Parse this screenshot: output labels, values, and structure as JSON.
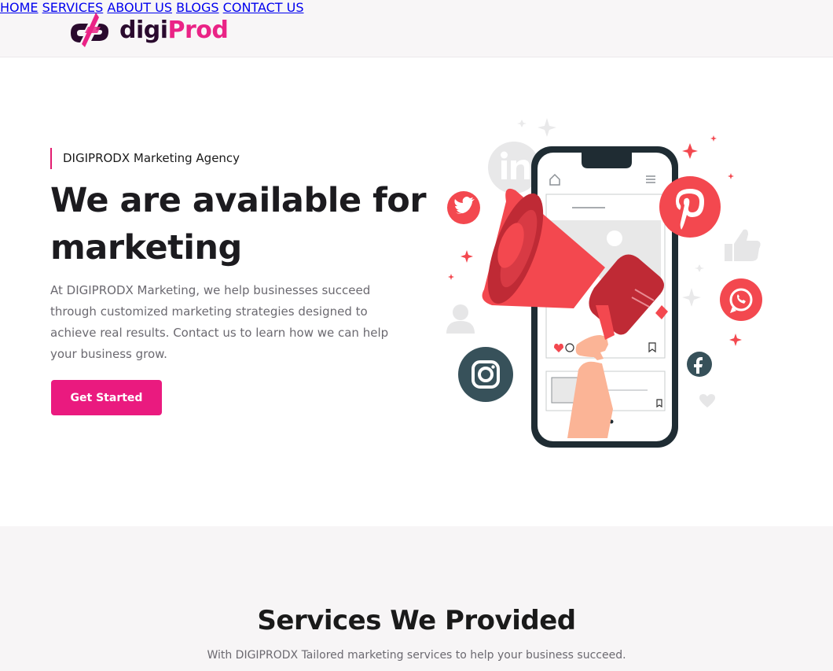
{
  "brand": {
    "name_part1": "digi",
    "name_part2": "Prod",
    "accent_color": "#ea1a7f",
    "dark_color": "#2a0a2e"
  },
  "nav": {
    "items": [
      {
        "label": "HOME"
      },
      {
        "label": "SERVICES"
      },
      {
        "label": "ABOUT US"
      },
      {
        "label": "BLOGS"
      },
      {
        "label": "CONTACT US"
      }
    ]
  },
  "hero": {
    "eyebrow": "DIGIPRODX Marketing Agency",
    "title": "We are available for marketing",
    "description": "At DIGIPRODX Marketing, we help businesses succeed through customized marketing strategies designed to achieve real results. Contact us to learn how we can help your business grow.",
    "cta_label": "Get Started"
  },
  "illustration": {
    "icons": [
      "linkedin-icon",
      "twitter-icon",
      "pinterest-icon",
      "thumbs-up-icon",
      "whatsapp-icon",
      "user-icon",
      "instagram-icon",
      "facebook-icon",
      "heart-icon",
      "megaphone-icon",
      "smartphone-icon"
    ],
    "colors": {
      "red": "#f3484f",
      "dark_teal": "#37515a",
      "phone_frame": "#1f2c33"
    }
  },
  "services": {
    "title": "Services We Provided",
    "subtitle": "With DIGIPRODX Tailored marketing services to help your business succeed."
  }
}
